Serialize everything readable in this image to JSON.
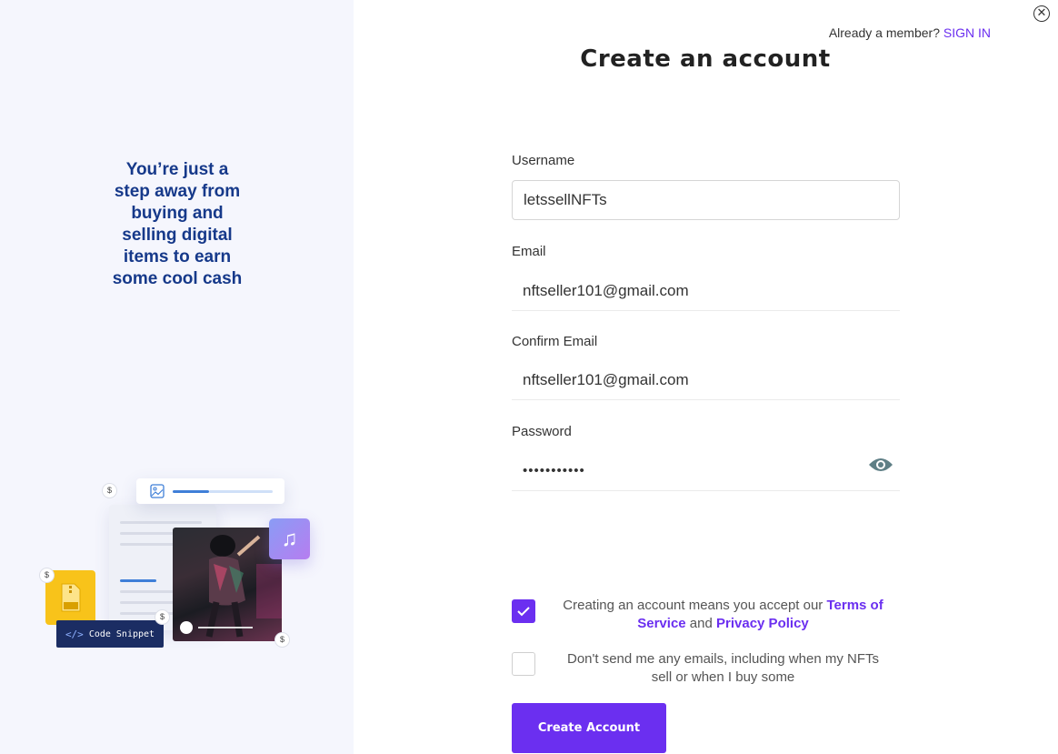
{
  "left_panel": {
    "tagline": "You’re just a\nstep away from\nbuying and\nselling digital\nitems to earn\nsome cool cash",
    "illustration": {
      "code_snippet_label": "Code Snippet",
      "code_icon": "</>",
      "zip_label": "ZIP",
      "dollar_symbol": "$"
    }
  },
  "header": {
    "member_prompt": "Already a member?",
    "signin_label": "SIGN IN",
    "close_icon": "close-icon"
  },
  "form": {
    "title": "Create an account",
    "username": {
      "label": "Username",
      "value": "letssellNFTs"
    },
    "email": {
      "label": "Email",
      "value": "nftseller101@gmail.com"
    },
    "confirm_email": {
      "label": "Confirm Email",
      "value": "nftseller101@gmail.com"
    },
    "password": {
      "label": "Password",
      "value": "•••••••••••",
      "toggle_icon": "eye-icon"
    },
    "terms": {
      "checked": true,
      "text_before": "Creating an account means you accept our ",
      "terms_link": "Terms of Service",
      "and_text": " and ",
      "privacy_link": "Privacy Policy"
    },
    "no_emails": {
      "checked": false,
      "text": "Don't send me any emails, including when my NFTs sell or when I buy some"
    },
    "submit_label": "Create Account"
  },
  "colors": {
    "accent": "#6b2ff0",
    "tagline": "#16398a",
    "left_bg": "#f5f6fd"
  }
}
